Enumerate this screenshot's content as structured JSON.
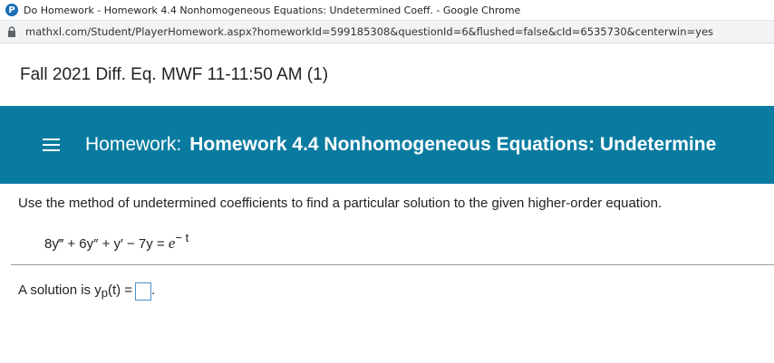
{
  "browser": {
    "window_title": "Do Homework - Homework 4.4 Nonhomogeneous Equations: Undetermined Coeff. - Google Chrome",
    "url": "mathxl.com/Student/PlayerHomework.aspx?homeworkId=599185308&questionId=6&flushed=false&cId=6535730&centerwin=yes"
  },
  "course": {
    "title": "Fall 2021 Diff. Eq. MWF 11-11:50 AM (1)"
  },
  "homework": {
    "label": "Homework:",
    "title": "Homework 4.4 Nonhomogeneous Equations: Undetermine"
  },
  "question": {
    "instructions": "Use the method of undetermined coefficients to find a particular solution to the given higher-order equation.",
    "equation_lhs": "8y‴ + 6y″ + y′ − 7y = ",
    "equation_base": "e",
    "equation_exponent": "− t",
    "solution_prefix": "A solution is y",
    "solution_subscript": "p",
    "solution_suffix": "(t) =",
    "solution_period": "."
  },
  "colors": {
    "header_bg": "#0a7ba0",
    "answer_box_border": "#4a90c8"
  }
}
